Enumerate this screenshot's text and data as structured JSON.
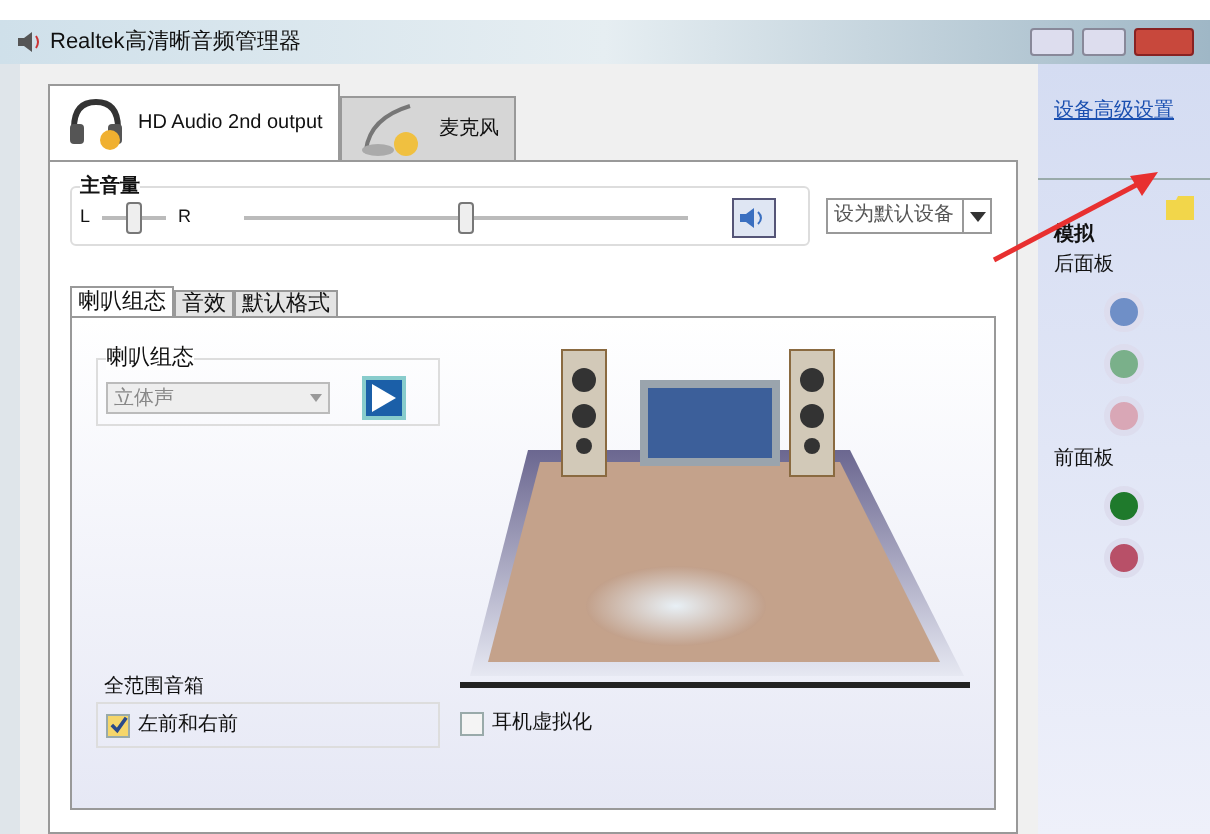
{
  "window": {
    "title": "Realtek高清晰音频管理器"
  },
  "device_tabs": [
    {
      "label": "HD Audio 2nd output",
      "selected": true
    },
    {
      "label": "麦克风",
      "selected": false
    }
  ],
  "volume": {
    "label": "主音量",
    "left": "L",
    "right": "R",
    "balance": {
      "level": 0.5
    },
    "level": 0.5,
    "muted": false
  },
  "default_device": "设为默认设备",
  "sub_tabs": [
    {
      "label": "喇叭组态",
      "selected": true
    },
    {
      "label": "音效",
      "selected": false
    },
    {
      "label": "默认格式",
      "selected": false
    }
  ],
  "speaker_config": {
    "label": "喇叭组态",
    "value": "立体声"
  },
  "full_range": {
    "label": "全范围音箱",
    "options": [
      {
        "label": "左前和右前",
        "checked": true
      }
    ]
  },
  "virtualization": {
    "label": "耳机虚拟化",
    "checked": false
  },
  "sidebar": {
    "link": "设备高级设置",
    "analog_label": "模拟",
    "panels": [
      {
        "label": "后面板",
        "jacks": [
          {
            "color": "#6f8fc7"
          },
          {
            "color": "#7ab08a"
          },
          {
            "color": "#d9a7b6"
          }
        ]
      },
      {
        "label": "前面板",
        "jacks": [
          {
            "color": "#1f7a2c"
          },
          {
            "color": "#b85068"
          }
        ]
      }
    ]
  }
}
